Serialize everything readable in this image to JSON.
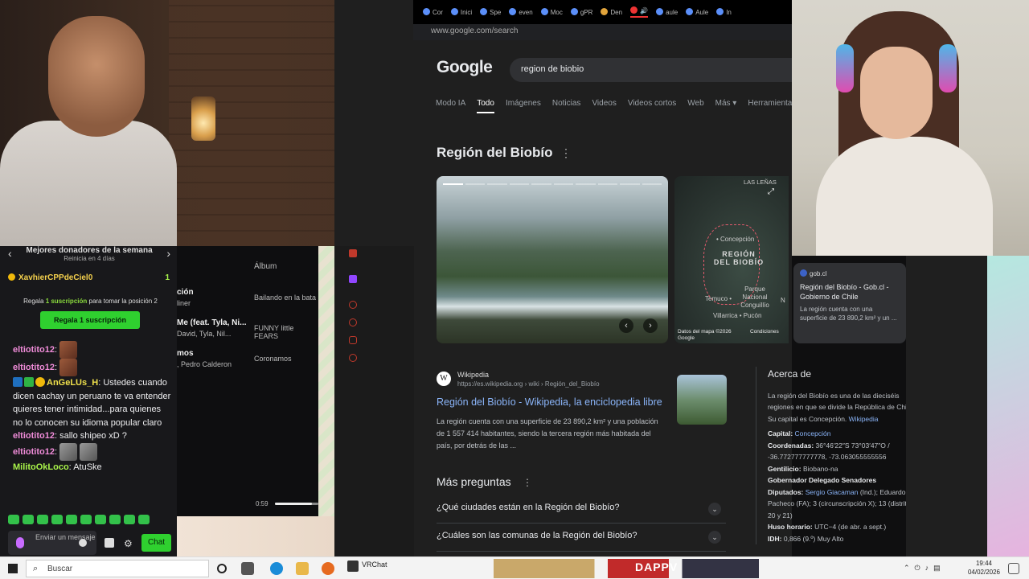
{
  "browser": {
    "tabs": [
      "Cor",
      "Inici",
      "Spe",
      "even",
      "Moc",
      "gPR",
      "Den",
      "",
      "",
      "aule",
      "Aule",
      "In"
    ],
    "url": "www.google.com/search"
  },
  "google": {
    "logo": "Google",
    "query": "region de biobio",
    "tabs": [
      "Modo IA",
      "Todo",
      "Imágenes",
      "Noticias",
      "Videos",
      "Videos cortos",
      "Web",
      "Más ▾",
      "Herramienta"
    ],
    "active_tab": "Todo",
    "kp_title": "Región del Biobío",
    "map": {
      "labels": {
        "top": "LAS LEÑAS",
        "city1": "• Concepción",
        "region": "REGIÓN DEL BIOBÍO",
        "city2": "Temuco •",
        "park": "Parque Nacional Conguillío",
        "villarrica": "Villarrica • Pucón",
        "n": "N"
      },
      "footer_left": "Datos del mapa ©2026 Google",
      "footer_right": "Condiciones"
    },
    "gob_card": {
      "source": "gob.cl",
      "title": "Región del Biobío - Gob.cl - Gobierno de Chile",
      "desc": "La región cuenta con una superficie de 23 890,2 km² y un ..."
    },
    "result": {
      "site_name": "Wikipedia",
      "site_url": "https://es.wikipedia.org › wiki › Región_del_Biobío",
      "title": "Región del Biobío - Wikipedia, la enciclopedia libre",
      "snippet": "La región cuenta con una superficie de 23 890,2 km² y una población de 1 557 414 habitantes, siendo la tercera región más habitada del país, por detrás de las ..."
    },
    "paa": {
      "title": "Más preguntas",
      "questions": [
        "¿Qué ciudades están en la Región del Biobío?",
        "¿Cuáles son las comunas de la Región del Biobío?"
      ]
    },
    "about": {
      "title": "Acerca de",
      "desc": "La región del Biobío es una de las dieciséis regiones en que se divide la República de Chile. Su capital es Concepción.",
      "desc_link": "Wikipedia",
      "capital_label": "Capital:",
      "capital_value": "Concepción",
      "coords_label": "Coordenadas:",
      "coords_value": "36°46′22″S 73°03′47″O / -36.772777777778, -73.063055555556",
      "gentilicio_label": "Gentilicio:",
      "gentilicio_value": "Biobano-na",
      "gob_label": "Gobernador Delegado Senadores",
      "diputados_label": "Diputados:",
      "diputados_link": "Sergio Giacaman",
      "diputados_rest": "(Ind.); Eduardo Pacheco (FA); 3 (circunscripción X); 13 (distritos 20 y 21)",
      "huso_label": "Huso horario:",
      "huso_value": "UTC−4 (de abr. a sept.)",
      "idh_label": "IDH:",
      "idh_value": "0,866 (9.º) Muy Alto"
    }
  },
  "chat": {
    "donors_title": "Mejores donadores de la semana",
    "donors_sub": "Reinicia en 4 días",
    "top_donor": "XavhierCPPdeCiel0",
    "top_donor_count": "1",
    "gift_msg_pre": "Regala ",
    "gift_msg_bold": "1 suscripción",
    "gift_msg_post": " para tomar la posición 2",
    "gift_button": "Regala 1 suscripción",
    "messages": [
      {
        "user": "eltiotito12",
        "text": ""
      },
      {
        "user": "eltiotito12",
        "text": ""
      },
      {
        "user": "AnGeLUs_H",
        "text": "Ustedes cuando dicen cachay un peruano te va entender quieres tener intimidad...para quienes no lo conocen su idioma popular claro"
      },
      {
        "user": "eltiotito12",
        "text": "sallo shipeo xD ?"
      },
      {
        "user": "eltiotito12",
        "text": ""
      },
      {
        "user": "MilitoOkLoco",
        "text": "AtuSke"
      }
    ],
    "input_placeholder": "Enviar un mensaje",
    "chat_button": "Chat"
  },
  "music": {
    "album_header": "Álbum",
    "rows": [
      {
        "title": "ción",
        "artist": "liner",
        "album": "Bailando en la bata"
      },
      {
        "title": "Me (feat. Tyla, Ni...",
        "artist": "David, Tyla, Nil...",
        "album": "FUNNY little FEARS"
      },
      {
        "title": "mos",
        "artist": ", Pedro Calderon",
        "album": "Coronamos"
      }
    ],
    "time": "0:59",
    "progress": 0.85
  },
  "taskbar": {
    "search_placeholder": "Buscar",
    "vrchat": "VRChat",
    "thumb_text": "DAPPV",
    "time": "19:44",
    "date": "04/02/2026"
  }
}
